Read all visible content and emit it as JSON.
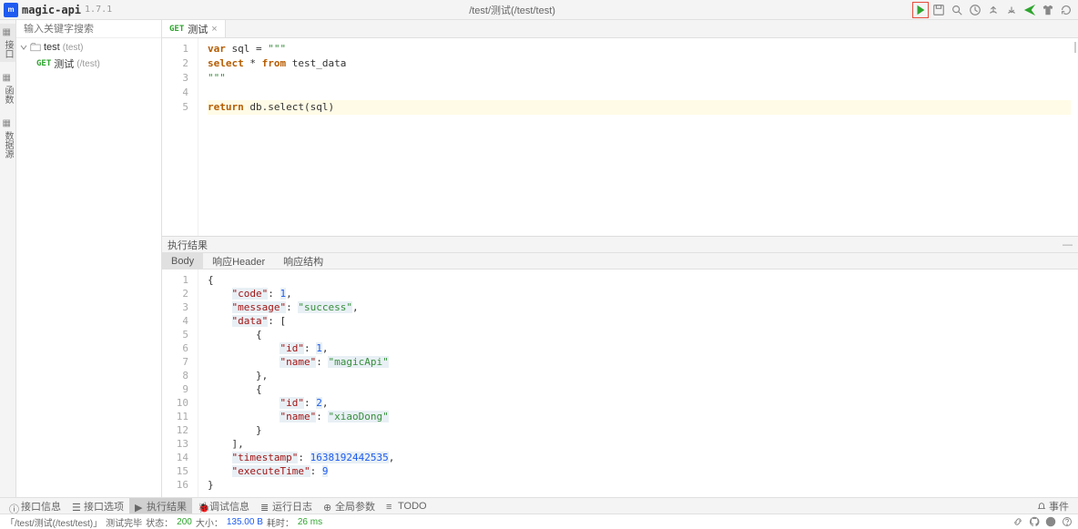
{
  "header": {
    "app_name": "magic-api",
    "version": "1.7.1",
    "center_path": "/test/测试(/test/test)"
  },
  "left_tabs": [
    "接口",
    "函数",
    "数据源"
  ],
  "sidebar": {
    "search_placeholder": "输入关键字搜索",
    "folder": {
      "name": "test",
      "path": "(test)"
    },
    "api": {
      "method": "GET",
      "name": "测试",
      "path": "(/test)"
    }
  },
  "editor_tab": {
    "method": "GET",
    "name": "测试"
  },
  "code_lines": [
    {
      "n": 1,
      "html": "<span class='kw'>var</span> sql = <span class='str'>\"\"\"</span>"
    },
    {
      "n": 2,
      "html": "<span class='kw'>select</span> * <span class='kw'>from</span> test_data"
    },
    {
      "n": 3,
      "html": "<span class='str'>\"\"\"</span>"
    },
    {
      "n": 4,
      "html": ""
    },
    {
      "n": 5,
      "hl": true,
      "html": "<span class='kw'>return</span> db.select(sql)"
    }
  ],
  "result_panel": {
    "title": "执行结果"
  },
  "result_tabs": [
    "Body",
    "响应Header",
    "响应结构"
  ],
  "result_lines": [
    {
      "n": 1,
      "html": "{"
    },
    {
      "n": 2,
      "html": "    <span class='jkey'>\"code\"</span>: <span class='jnum'>1</span>,"
    },
    {
      "n": 3,
      "html": "    <span class='jkey'>\"message\"</span>: <span class='jstr'>\"success\"</span>,"
    },
    {
      "n": 4,
      "html": "    <span class='jkey'>\"data\"</span>: ["
    },
    {
      "n": 5,
      "html": "        {"
    },
    {
      "n": 6,
      "html": "            <span class='jkey'>\"id\"</span>: <span class='jnum'>1</span>,"
    },
    {
      "n": 7,
      "html": "            <span class='jkey'>\"name\"</span>: <span class='jstr'>\"magicApi\"</span>"
    },
    {
      "n": 8,
      "html": "        },"
    },
    {
      "n": 9,
      "html": "        {"
    },
    {
      "n": 10,
      "html": "            <span class='jkey'>\"id\"</span>: <span class='jnum'>2</span>,"
    },
    {
      "n": 11,
      "html": "            <span class='jkey'>\"name\"</span>: <span class='jstr'>\"xiaoDong\"</span>"
    },
    {
      "n": 12,
      "html": "        }"
    },
    {
      "n": 13,
      "html": "    ],"
    },
    {
      "n": 14,
      "html": "    <span class='jkey'>\"timestamp\"</span>: <span class='jnum'>1638192442535</span>,"
    },
    {
      "n": 15,
      "html": "    <span class='jkey'>\"executeTime\"</span>: <span class='jnum'>9</span>"
    },
    {
      "n": 16,
      "html": "}"
    }
  ],
  "bottom_tabs": [
    {
      "icon": "info",
      "label": "接口信息"
    },
    {
      "icon": "opt",
      "label": "接口选项"
    },
    {
      "icon": "play",
      "label": "执行结果",
      "active": true
    },
    {
      "icon": "bug",
      "label": "调试信息"
    },
    {
      "icon": "log",
      "label": "运行日志"
    },
    {
      "icon": "globe",
      "label": "全局参数"
    },
    {
      "icon": "todo",
      "label": "TODO"
    }
  ],
  "events_label": "事件",
  "status": {
    "path": "「/test/测试(/test/test)」",
    "done": "测试完毕",
    "status_label": "状态：",
    "status_code": "200",
    "size_label": "大小：",
    "size_value": "135.00 B",
    "time_label": "耗时：",
    "time_value": "26 ms"
  }
}
